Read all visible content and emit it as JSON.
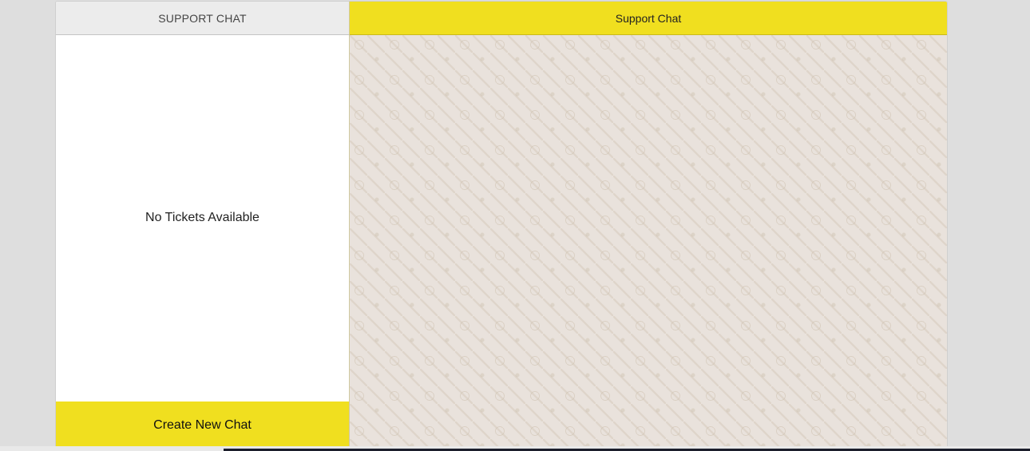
{
  "sidebar": {
    "title": "SUPPORT CHAT",
    "empty_message": "No Tickets Available",
    "create_button": "Create New Chat"
  },
  "chat": {
    "title": "Support Chat"
  },
  "colors": {
    "accent": "#f0df1f",
    "chat_background": "#e9e2dc"
  }
}
